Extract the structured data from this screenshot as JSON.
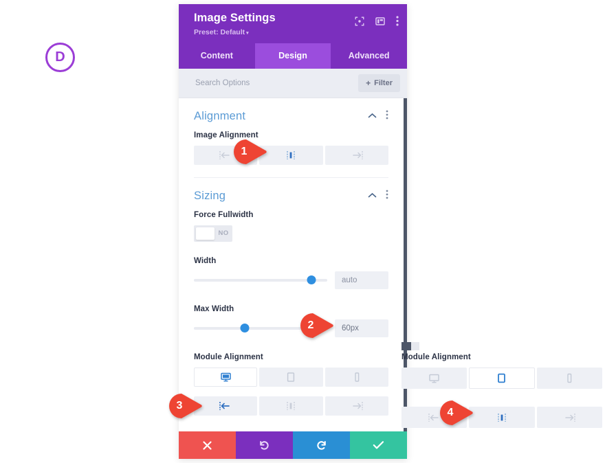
{
  "logo": {
    "letter": "D",
    "color": "#9b3dd6",
    "name": "divi-logo"
  },
  "panel": {
    "title": "Image Settings",
    "preset": "Preset: Default",
    "preset_caret": "▾",
    "header_icons": [
      "fullscreen-icon",
      "layout-panel-icon",
      "more-options-icon"
    ],
    "tabs": [
      {
        "label": "Content",
        "active": false
      },
      {
        "label": "Design",
        "active": true
      },
      {
        "label": "Advanced",
        "active": false
      }
    ],
    "search": {
      "placeholder": "Search Options",
      "value": ""
    },
    "filter_button": {
      "label": "Filter",
      "plus": "+"
    },
    "sections": [
      {
        "title": "Alignment",
        "collapse_icon": "chevron-up-icon",
        "menu_icon": "more-options-icon",
        "fields": [
          {
            "label": "Image Alignment",
            "type": "segmented",
            "options": [
              "align-left-icon",
              "align-center-icon",
              "align-right-icon"
            ],
            "selected": 1
          }
        ]
      },
      {
        "title": "Sizing",
        "collapse_icon": "chevron-up-icon",
        "menu_icon": "more-options-icon",
        "fields": [
          {
            "label": "Force Fullwidth",
            "type": "toggle",
            "value": "NO",
            "on": false
          },
          {
            "label": "Width",
            "type": "slider",
            "percent": 88,
            "value": "",
            "placeholder": "auto"
          },
          {
            "label": "Max Width",
            "type": "slider",
            "percent": 38,
            "value": "60px",
            "placeholder": ""
          },
          {
            "label": "Module Alignment",
            "type": "device",
            "options": [
              "desktop-icon",
              "tablet-icon",
              "phone-icon"
            ],
            "selected": 0
          },
          {
            "label": "",
            "type": "segmented",
            "options": [
              "align-left-icon",
              "align-center-icon",
              "align-right-icon"
            ],
            "selected": 0
          }
        ]
      }
    ],
    "actions": [
      {
        "name": "cancel-button",
        "icon": "close-icon",
        "color": "#ef5350"
      },
      {
        "name": "undo-button",
        "icon": "undo-icon",
        "color": "#7b2fbe"
      },
      {
        "name": "redo-button",
        "icon": "redo-icon",
        "color": "#2a8fd4"
      },
      {
        "name": "save-button",
        "icon": "check-icon",
        "color": "#34c4a0"
      }
    ]
  },
  "right_panel": {
    "label": "Module Alignment",
    "device_options": [
      "desktop-icon",
      "tablet-icon",
      "phone-icon"
    ],
    "device_selected": 1,
    "align_options": [
      "align-left-icon",
      "align-center-icon",
      "align-right-icon"
    ],
    "align_selected": 1
  },
  "markers": [
    {
      "number": "1",
      "color": "#ee4433"
    },
    {
      "number": "2",
      "color": "#ee4433"
    },
    {
      "number": "3",
      "color": "#ee4433"
    },
    {
      "number": "4",
      "color": "#ee4433"
    }
  ]
}
